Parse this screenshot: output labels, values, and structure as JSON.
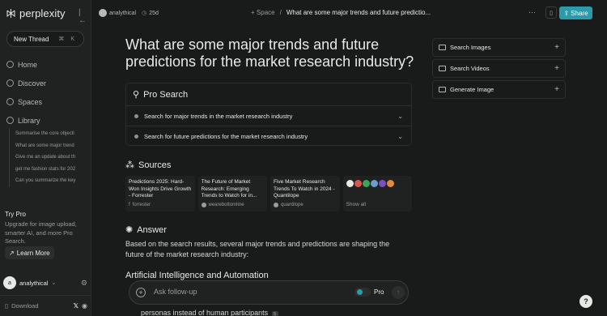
{
  "brand": {
    "name": "perplexity"
  },
  "sidebar": {
    "new_thread": "New Thread",
    "new_thread_shortcut": "⌘ K",
    "nav": [
      {
        "label": "Home",
        "icon": "home-icon"
      },
      {
        "label": "Discover",
        "icon": "globe-icon"
      },
      {
        "label": "Spaces",
        "icon": "spaces-icon"
      },
      {
        "label": "Library",
        "icon": "library-icon"
      }
    ],
    "library_items": [
      "Summarise the core objecti",
      "What are some major trend",
      "Give me an update about th",
      "get me fashion stats for 202",
      "Can you summarize the key"
    ],
    "try_pro": {
      "title": "Try Pro",
      "description": "Upgrade for image upload, smarter AI, and more Pro Search.",
      "button": "Learn More"
    },
    "user": {
      "name": "analythical",
      "initial": "a"
    },
    "download": "Download"
  },
  "topbar": {
    "space_owner": "analythical",
    "space_age": "25d",
    "space_label": "Space",
    "thread_title": "What are some major trends and future predictio...",
    "share": "Share"
  },
  "main": {
    "question": "What are some major trends and future predictions for the market research industry?",
    "pro_search": {
      "title": "Pro Search",
      "steps": [
        "Search for major trends in the market research industry",
        "Search for future predictions for the market research industry"
      ]
    },
    "sources": {
      "title": "Sources",
      "cards": [
        {
          "title": "Predictions 2025: Hard-Won Insights Drive Growth - Forrester",
          "site": "forrester"
        },
        {
          "title": "The Future of Market Research: Emerging Trends to Watch for in...",
          "site": "wearebottomline"
        },
        {
          "title": "Five Market Research Trends To Watch in 2024 - Quantilope",
          "site": "quantilope"
        }
      ],
      "favicon_colors": [
        "#e8e8e6",
        "#d9534f",
        "#3aa655",
        "#6c9bd2",
        "#7a4fbf",
        "#e08a3c"
      ],
      "show_all": "Show all"
    },
    "answer": {
      "title": "Answer",
      "text": "Based on the search results, several major trends and predictions are shaping the future of the market research industry:",
      "subheading": "Artificial Intelligence and Automation",
      "trailing_text": "personas instead of human participants",
      "trailing_cite": "5"
    },
    "followup": {
      "placeholder": "Ask follow-up",
      "pro_label": "Pro"
    }
  },
  "right_panel": {
    "items": [
      {
        "label": "Search Images"
      },
      {
        "label": "Search Videos"
      },
      {
        "label": "Generate Image"
      }
    ]
  },
  "help": "?",
  "colors": {
    "accent": "#2a9baa",
    "background": "#191a1a",
    "sidebar": "#202222"
  }
}
